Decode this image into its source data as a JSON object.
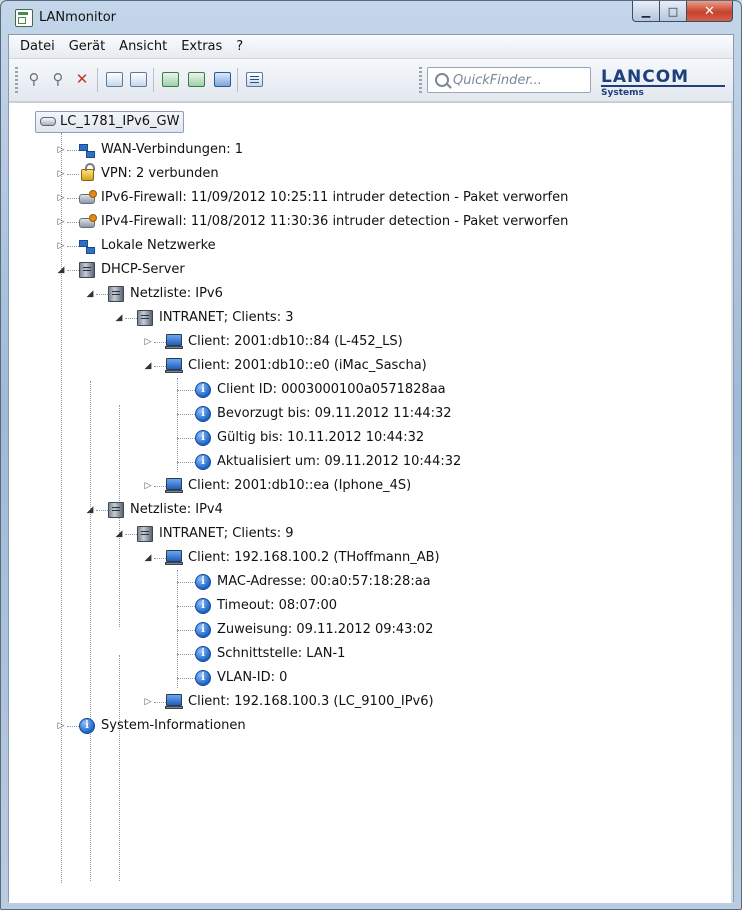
{
  "window": {
    "title": "LANmonitor"
  },
  "menu": [
    "Datei",
    "Gerät",
    "Ansicht",
    "Extras",
    "?"
  ],
  "quickfinder": {
    "placeholder": "QuickFinder..."
  },
  "brand": {
    "name": "LANCOM",
    "sub": "Systems"
  },
  "tree": {
    "root": "LC_1781_IPv6_GW",
    "wan": "WAN-Verbindungen: 1",
    "vpn": "VPN: 2 verbunden",
    "ipv6_fw": "IPv6-Firewall: 11/09/2012 10:25:11 intruder detection - Paket verworfen",
    "ipv4_fw": "IPv4-Firewall: 11/08/2012 11:30:36 intruder detection - Paket verworfen",
    "lan": "Lokale Netzwerke",
    "dhcp": "DHCP-Server",
    "nl6": "Netzliste: IPv6",
    "intranet6": "INTRANET; Clients: 3",
    "c6a": "Client: 2001:db10::84 (L-452_LS)",
    "c6b": "Client: 2001:db10::e0 (iMac_Sascha)",
    "c6b_id": "Client ID: 0003000100a0571828aa",
    "c6b_pref": "Bevorzugt bis: 09.11.2012 11:44:32",
    "c6b_valid": "Gültig bis: 10.11.2012 10:44:32",
    "c6b_upd": "Aktualisiert um: 09.11.2012 10:44:32",
    "c6c": "Client: 2001:db10::ea (Iphone_4S)",
    "nl4": "Netzliste: IPv4",
    "intranet4": "INTRANET; Clients: 9",
    "c4a": "Client: 192.168.100.2 (THoffmann_AB)",
    "c4a_mac": "MAC-Adresse: 00:a0:57:18:28:aa",
    "c4a_to": "Timeout: 08:07:00",
    "c4a_assign": "Zuweisung: 09.11.2012 09:43:02",
    "c4a_if": "Schnittstelle: LAN-1",
    "c4a_vlan": "VLAN-ID: 0",
    "c4b": "Client: 192.168.100.3 (LC_9100_IPv6)",
    "sysinfo": "System-Informationen"
  }
}
